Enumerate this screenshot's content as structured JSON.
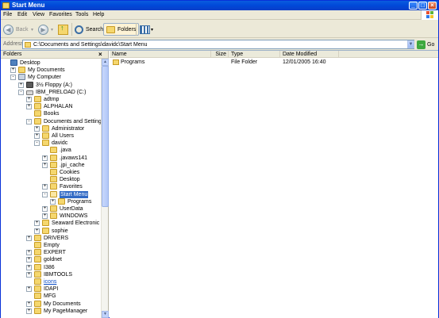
{
  "window": {
    "title": "Start Menu"
  },
  "menu": [
    "File",
    "Edit",
    "View",
    "Favorites",
    "Tools",
    "Help"
  ],
  "toolbar": {
    "back_label": "Back",
    "search_label": "Search",
    "folders_label": "Folders"
  },
  "address": {
    "label": "Address",
    "value": "C:\\Documents and Settings\\davidc\\Start Menu",
    "go_label": "Go"
  },
  "folders_pane": {
    "title": "Folders",
    "close": "×",
    "tree": [
      {
        "label": "Desktop",
        "indent": 0,
        "icon": "desktop-icon",
        "expander": ""
      },
      {
        "label": "My Documents",
        "indent": 1,
        "icon": "folder-icon",
        "expander": "+"
      },
      {
        "label": "My Computer",
        "indent": 1,
        "icon": "computer-icon",
        "expander": "-"
      },
      {
        "label": "3½ Floppy (A:)",
        "indent": 2,
        "icon": "floppy-icon",
        "expander": "+"
      },
      {
        "label": "IBM_PRELOAD (C:)",
        "indent": 2,
        "icon": "drive-icon",
        "expander": "-"
      },
      {
        "label": "adtmp",
        "indent": 3,
        "icon": "folder-icon",
        "expander": "+"
      },
      {
        "label": "ALPHALAN",
        "indent": 3,
        "icon": "folder-icon",
        "expander": "+"
      },
      {
        "label": "Books",
        "indent": 3,
        "icon": "folder-icon",
        "expander": ""
      },
      {
        "label": "Documents and Settings",
        "indent": 3,
        "icon": "folder-icon",
        "expander": "-"
      },
      {
        "label": "Administrator",
        "indent": 4,
        "icon": "folder-icon",
        "expander": "+"
      },
      {
        "label": "All Users",
        "indent": 4,
        "icon": "folder-icon",
        "expander": "+"
      },
      {
        "label": "davidc",
        "indent": 4,
        "icon": "folder-icon",
        "expander": "-"
      },
      {
        "label": ".java",
        "indent": 5,
        "icon": "folder-icon",
        "expander": ""
      },
      {
        "label": ".javaws141",
        "indent": 5,
        "icon": "folder-icon",
        "expander": "+"
      },
      {
        "label": ".jpi_cache",
        "indent": 5,
        "icon": "folder-icon",
        "expander": "+"
      },
      {
        "label": "Cookies",
        "indent": 5,
        "icon": "folder-icon",
        "expander": ""
      },
      {
        "label": "Desktop",
        "indent": 5,
        "icon": "folder-icon",
        "expander": ""
      },
      {
        "label": "Favorites",
        "indent": 5,
        "icon": "star-folder-icon",
        "expander": "+"
      },
      {
        "label": "Start Menu",
        "indent": 5,
        "icon": "open-folder-icon",
        "expander": "-",
        "selected": true
      },
      {
        "label": "Programs",
        "indent": 6,
        "icon": "programs-icon",
        "expander": "+"
      },
      {
        "label": "UserData",
        "indent": 5,
        "icon": "folder-icon",
        "expander": "+"
      },
      {
        "label": "WINDOWS",
        "indent": 5,
        "icon": "folder-icon",
        "expander": "+"
      },
      {
        "label": "Seaward Electronic",
        "indent": 4,
        "icon": "folder-icon",
        "expander": "+"
      },
      {
        "label": "sophie",
        "indent": 4,
        "icon": "folder-icon",
        "expander": "+"
      },
      {
        "label": "DRIVERS",
        "indent": 3,
        "icon": "folder-icon",
        "expander": "+"
      },
      {
        "label": "Empty",
        "indent": 3,
        "icon": "folder-icon",
        "expander": ""
      },
      {
        "label": "EXPERT",
        "indent": 3,
        "icon": "folder-icon",
        "expander": "+"
      },
      {
        "label": "goldnet",
        "indent": 3,
        "icon": "folder-icon",
        "expander": "+"
      },
      {
        "label": "I386",
        "indent": 3,
        "icon": "folder-icon",
        "expander": "+"
      },
      {
        "label": "IBMTOOLS",
        "indent": 3,
        "icon": "folder-icon",
        "expander": "+"
      },
      {
        "label": "icons",
        "indent": 3,
        "icon": "folder-icon",
        "expander": "",
        "link": true
      },
      {
        "label": "IDAPI",
        "indent": 3,
        "icon": "folder-icon",
        "expander": "+"
      },
      {
        "label": "MFG",
        "indent": 3,
        "icon": "folder-icon",
        "expander": ""
      },
      {
        "label": "My Documents",
        "indent": 3,
        "icon": "folder-icon",
        "expander": "+"
      },
      {
        "label": "My PageManager",
        "indent": 3,
        "icon": "folder-icon",
        "expander": "+"
      }
    ]
  },
  "list": {
    "columns": [
      "Name",
      "Size",
      "Type",
      "Date Modified"
    ],
    "rows": [
      {
        "name": "Programs",
        "size": "",
        "type": "File Folder",
        "date": "12/01/2005 16:40"
      }
    ]
  }
}
